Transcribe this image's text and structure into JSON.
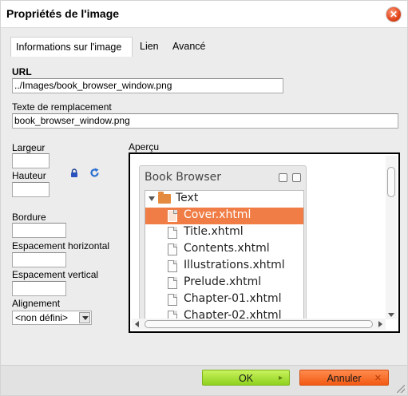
{
  "dialog": {
    "title": "Propriétés de l'image",
    "close_icon": "close-icon"
  },
  "tabs": [
    {
      "label": "Informations sur l'image",
      "active": true
    },
    {
      "label": "Lien",
      "active": false
    },
    {
      "label": "Avancé",
      "active": false
    }
  ],
  "form": {
    "url_label": "URL",
    "url_value": "../Images/book_browser_window.png",
    "alt_label": "Texte de remplacement",
    "alt_value": "book_browser_window.png",
    "width_label": "Largeur",
    "width_value": "",
    "height_label": "Hauteur",
    "height_value": "",
    "lock_icon": "lock-icon",
    "reset_icon": "refresh-icon",
    "border_label": "Bordure",
    "border_value": "",
    "hspace_label": "Espacement horizontal",
    "hspace_value": "",
    "vspace_label": "Espacement vertical",
    "vspace_value": "",
    "align_label": "Alignement",
    "align_value": "<non défini>"
  },
  "preview": {
    "label": "Aperçu",
    "window_title": "Book Browser",
    "tree": {
      "folder": "Text",
      "items": [
        {
          "name": "Cover.xhtml",
          "selected": true
        },
        {
          "name": "Title.xhtml",
          "selected": false
        },
        {
          "name": "Contents.xhtml",
          "selected": false
        },
        {
          "name": "Illustrations.xhtml",
          "selected": false
        },
        {
          "name": "Prelude.xhtml",
          "selected": false
        },
        {
          "name": "Chapter-01.xhtml",
          "selected": false
        },
        {
          "name": "Chapter-02.xhtml",
          "selected": false
        }
      ]
    }
  },
  "footer": {
    "ok_label": "OK",
    "cancel_label": "Annuler"
  },
  "colors": {
    "ok_green": "#9ad82a",
    "cancel_orange": "#f4661e",
    "selection_orange": "#f07d45",
    "folder_orange": "#e58b3f"
  }
}
